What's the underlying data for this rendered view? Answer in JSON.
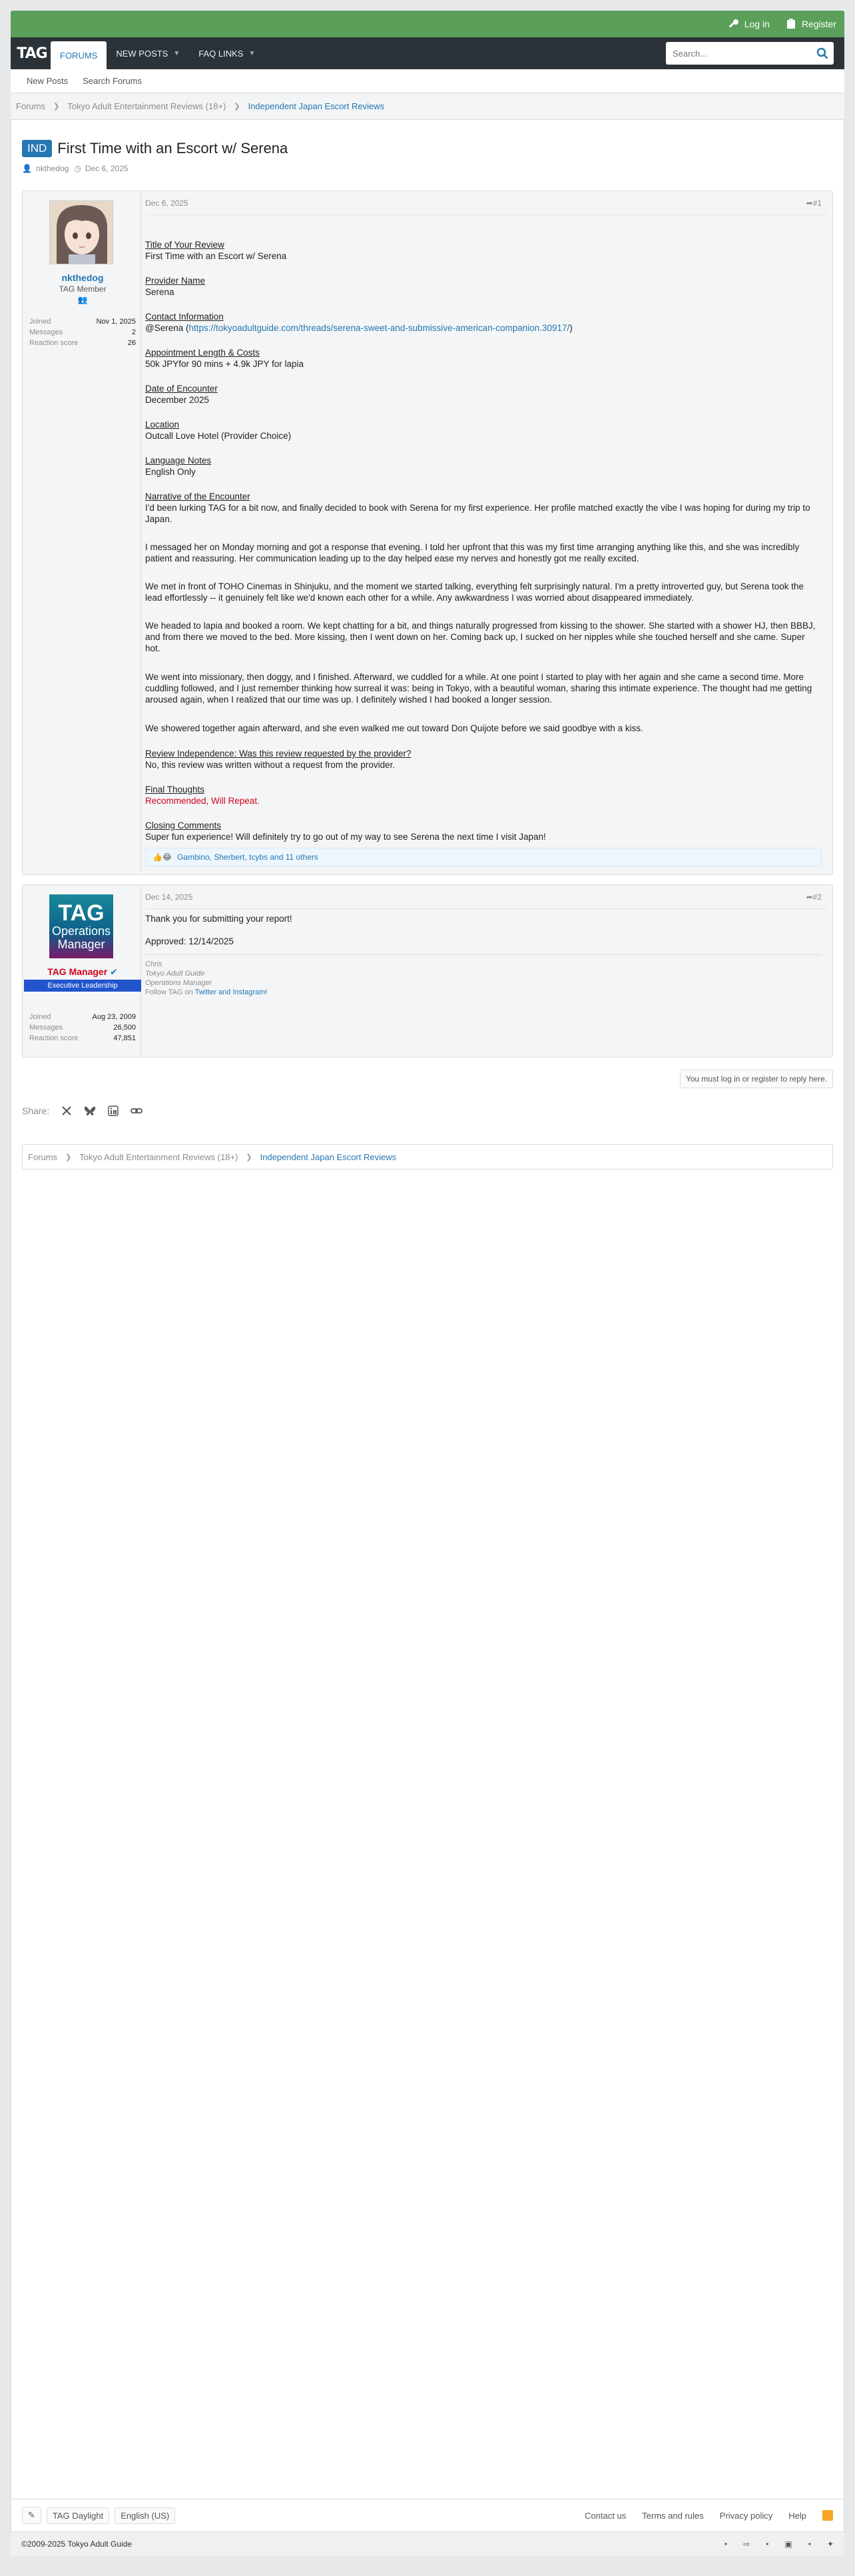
{
  "header": {
    "login": "Log in",
    "register": "Register",
    "logo": "TAG",
    "nav": [
      {
        "label": "FORUMS"
      },
      {
        "label": "NEW POSTS"
      },
      {
        "label": "FAQ LINKS"
      }
    ],
    "search_placeholder": "Search...",
    "subnav": [
      "New Posts",
      "Search Forums"
    ]
  },
  "breadcrumb": [
    "Forums",
    "Tokyo Adult Entertainment Reviews (18+)",
    "Independent Japan Escort Reviews"
  ],
  "thread": {
    "prefix": "IND",
    "title": "First Time with an Escort w/ Serena",
    "author": "nkthedog",
    "date": "Dec 6, 2025"
  },
  "post1": {
    "username": "nkthedog",
    "user_title": "TAG Member",
    "stats": [
      {
        "label": "Joined",
        "value": "Nov 1, 2025"
      },
      {
        "label": "Messages",
        "value": "2"
      },
      {
        "label": "Reaction score",
        "value": "26"
      }
    ],
    "date": "Dec 6, 2025",
    "number": "#1",
    "sections": [
      {
        "label": "Title of Your Review",
        "value": "First Time with an Escort w/ Serena"
      },
      {
        "label": "Provider Name",
        "value": "Serena"
      },
      {
        "label": "Contact Information",
        "value_prefix": "@Serena (",
        "link": "https://tokyoadultguide.com/threads/serena-sweet-and-submissive-american-companion.30917/",
        "value_suffix": ")"
      },
      {
        "label": "Appointment Length & Costs",
        "value": "50k JPYfor 90 mins + 4.9k JPY for lapia"
      },
      {
        "label": "Date of Encounter",
        "value": "December 2025"
      },
      {
        "label": "Location",
        "value": "Outcall Love Hotel (Provider Choice)"
      },
      {
        "label": "Language Notes",
        "value": "English Only"
      }
    ],
    "narrative_label": "Narrative of the Encounter",
    "narrative": [
      "I'd been lurking TAG for a bit now, and finally decided to book with Serena for my first experience. Her profile matched exactly the vibe I was hoping for during my trip to Japan.",
      "I messaged her on Monday morning and got a response that evening. I told her upfront that this was my first time arranging anything like this, and she was incredibly patient and reassuring. Her communication leading up to the day helped ease my nerves and honestly got me really excited.",
      "We met in front of TOHO Cinemas in Shinjuku, and the moment we started talking, everything felt surprisingly natural. I'm a pretty introverted guy, but Serena took the lead effortlessly -- it genuinely felt like we'd known each other for a while. Any awkwardness I was worried about disappeared immediately.",
      "We headed to lapia and booked a room. We kept chatting for a bit, and things naturally progressed from kissing to the shower. She started with a shower HJ, then BBBJ, and from there we moved to the bed. More kissing, then I went down on her. Coming back up, I sucked on her nipples while she touched herself and she came. Super hot.",
      "We went into missionary, then doggy, and I finished. Afterward, we cuddled for a while. At one point I started to play with her again and she came a second time. More cuddling followed, and I just remember thinking how surreal it was: being in Tokyo, with a beautiful woman, sharing this intimate experience. The thought had me getting aroused again, when I realized that our time was up. I definitely wished I had booked a longer session.",
      "We showered together again afterward, and she even walked me out toward Don Quijote before we said goodbye with a kiss."
    ],
    "independence_label": "Review Independence: Was this review requested by the provider?",
    "independence_value": "No, this review was written without a request from the provider.",
    "final_label": "Final Thoughts",
    "final_value": "Recommended, Will Repeat.",
    "closing_label": "Closing Comments",
    "closing_value": "Super fun experience! Will definitely try to go out of my way to see Serena the next time I visit Japan!",
    "reactions": "Gambino, Sherbert, tcybs and 11 others"
  },
  "post2": {
    "avatar_lines": [
      "TAG",
      "Operations",
      "Manager"
    ],
    "username": "TAG Manager",
    "badge": "Executive Leadership",
    "stats": [
      {
        "label": "Joined",
        "value": "Aug 23, 2009"
      },
      {
        "label": "Messages",
        "value": "26,500"
      },
      {
        "label": "Reaction score",
        "value": "47,851"
      }
    ],
    "date": "Dec 14, 2025",
    "number": "#2",
    "body": [
      "Thank you for submitting your report!",
      "Approved: 12/14/2025"
    ],
    "signature": [
      "Chris",
      "Tokyo Adult Guide",
      "Operations Manager"
    ],
    "sig_follow_prefix": "Follow TAG on ",
    "sig_follow_link": "Twitter and Instagram!"
  },
  "reply_note": "You must log in or register to reply here.",
  "share_label": "Share:",
  "footer": {
    "style": "TAG Daylight",
    "language": "English (US)",
    "links": [
      "Contact us",
      "Terms and rules",
      "Privacy policy",
      "Help"
    ],
    "copyright": "©2009-2025 Tokyo Adult Guide"
  },
  "colors": {
    "topbar": "#5aa05a",
    "nav": "#2c3338",
    "link": "#2577b1",
    "prefix": "#2577b1",
    "recommended": "#d0021b"
  }
}
